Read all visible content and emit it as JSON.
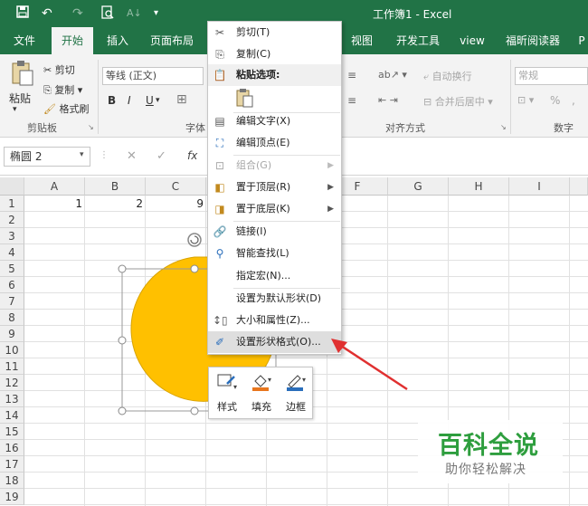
{
  "title": "工作簿1  -  Excel",
  "quick_access": {
    "save_icon": "save-icon",
    "undo": "↶",
    "redo": "↷",
    "preview_icon": "print-preview-icon",
    "sort_icon": "sort-icon",
    "more": "▾"
  },
  "tabs": [
    {
      "label": "文件"
    },
    {
      "label": "开始"
    },
    {
      "label": "插入"
    },
    {
      "label": "页面布局"
    },
    {
      "label": "视图"
    },
    {
      "label": "开发工具"
    },
    {
      "label": "view"
    },
    {
      "label": "福昕阅读器"
    },
    {
      "label": "P"
    }
  ],
  "ribbon": {
    "clipboard": {
      "paste": "粘贴",
      "cut": "剪切",
      "copy": "复制",
      "format_painter": "格式刷",
      "group": "剪贴板"
    },
    "font": {
      "font_name": "等线 (正文)",
      "bold": "B",
      "italic": "I",
      "underline": "U",
      "group": "字体"
    },
    "alignment": {
      "wrap": "自动换行",
      "merge": "合并后居中",
      "group": "对齐方式"
    },
    "number": {
      "format": "常规",
      "percent": "%",
      "comma": ",",
      "group": "数字"
    }
  },
  "formula_bar": {
    "name_box": "椭圆 2",
    "fx": "fx",
    "cancel": "✕",
    "confirm": "✓"
  },
  "columns": [
    "A",
    "B",
    "C",
    "D",
    "E",
    "F",
    "G",
    "H",
    "I"
  ],
  "rows": [
    "1",
    "2",
    "3",
    "4",
    "5",
    "6",
    "7",
    "8",
    "9",
    "10",
    "11",
    "12",
    "13",
    "14",
    "15",
    "16",
    "17",
    "18",
    "19"
  ],
  "cells": {
    "A1": "1",
    "B1": "2",
    "C1": "9"
  },
  "shape": {
    "fill": "#FFC000",
    "border": "#D9A300"
  },
  "context_menu": {
    "items": [
      {
        "label": "剪切(T)",
        "icon": "cut-icon"
      },
      {
        "label": "复制(C)",
        "icon": "copy-icon"
      },
      {
        "label": "粘贴选项:",
        "icon": "paste-icon"
      },
      {
        "label": "编辑文字(X)",
        "icon": "edit-text-icon"
      },
      {
        "label": "编辑顶点(E)",
        "icon": "edit-points-icon"
      },
      {
        "label": "组合(G)",
        "icon": "group-icon"
      },
      {
        "label": "置于顶层(R)",
        "icon": "bring-front-icon"
      },
      {
        "label": "置于底层(K)",
        "icon": "send-back-icon"
      },
      {
        "label": "链接(I)",
        "icon": "link-icon"
      },
      {
        "label": "智能查找(L)",
        "icon": "smart-lookup-icon"
      },
      {
        "label": "指定宏(N)...",
        "icon": ""
      },
      {
        "label": "设置为默认形状(D)",
        "icon": ""
      },
      {
        "label": "大小和属性(Z)...",
        "icon": "size-icon"
      },
      {
        "label": "设置形状格式(O)...",
        "icon": "format-shape-icon"
      }
    ]
  },
  "mini_toolbar": {
    "style": "样式",
    "fill": "填充",
    "outline": "边框"
  },
  "watermark": {
    "title": "百科全说",
    "subtitle": "助你轻松解决"
  },
  "colors": {
    "excel_green": "#217346",
    "arrow_red": "#E03030",
    "shape_fill": "#FFC000"
  }
}
